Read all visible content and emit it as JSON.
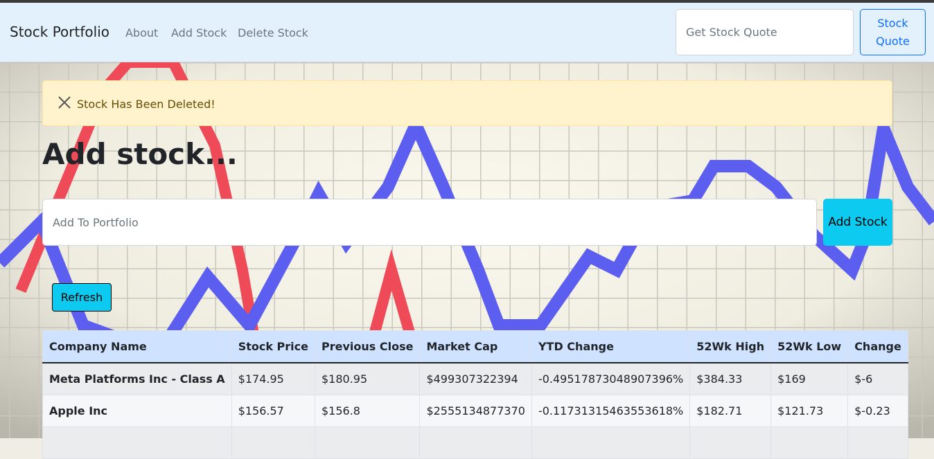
{
  "navbar": {
    "brand": "Stock Portfolio",
    "links": [
      "About",
      "Add Stock",
      "Delete Stock"
    ],
    "quote_placeholder": "Get Stock Quote",
    "quote_button": "Stock Quote"
  },
  "alert": {
    "message": "Stock Has Been Deleted!"
  },
  "main": {
    "heading": "Add stock...",
    "add_placeholder": "Add To Portfolio",
    "add_button": "Add Stock",
    "refresh_button": "Refresh"
  },
  "table": {
    "headers": [
      "Company Name",
      "Stock Price",
      "Previous Close",
      "Market Cap",
      "YTD Change",
      "52Wk High",
      "52Wk Low",
      "Change"
    ],
    "rows": [
      [
        "Meta Platforms Inc - Class A",
        "$174.95",
        "$180.95",
        "$499307322394",
        "-0.49517873048907396%",
        "$384.33",
        "$169",
        "$-6"
      ],
      [
        "Apple Inc",
        "$156.57",
        "$156.8",
        "$2555134877370",
        "-0.11731315463553618%",
        "$182.71",
        "$121.73",
        "$-0.23"
      ]
    ]
  },
  "background": {
    "red_line_color": "#ef4a57",
    "blue_line_color": "#5c5ef0",
    "grid_color": "#c9c7bd"
  }
}
